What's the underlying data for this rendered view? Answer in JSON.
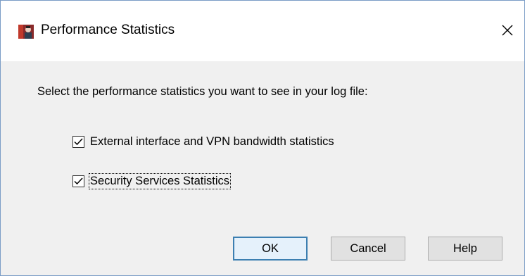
{
  "window": {
    "title": "Performance Statistics",
    "icon": "app-icon",
    "close_icon": "close-icon"
  },
  "dialog": {
    "prompt": "Select the performance statistics you want to see in your log file:",
    "options": [
      {
        "label": "External interface and VPN bandwidth statistics",
        "checked": true
      },
      {
        "label": "Security Services Statistics",
        "checked": true,
        "focused": true
      }
    ]
  },
  "buttons": {
    "ok": "OK",
    "cancel": "Cancel",
    "help": "Help"
  },
  "colors": {
    "default_button_border": "#3c7fb1",
    "default_button_bg": "#e5f1fb",
    "window_border": "#7a9cc6"
  }
}
